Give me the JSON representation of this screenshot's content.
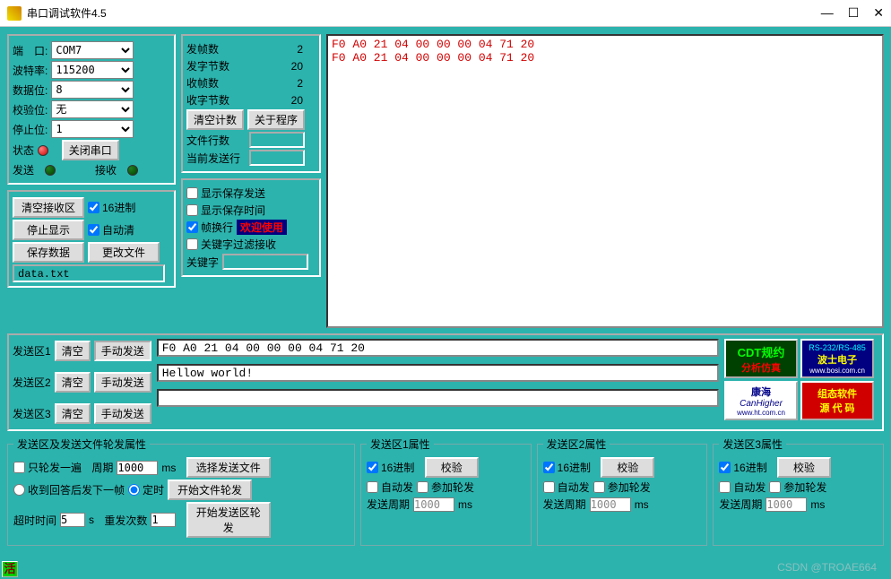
{
  "window": {
    "title": "串口调试软件4.5"
  },
  "port_settings": {
    "port_label": "端　口:",
    "port_value": "COM7",
    "baud_label": "波特率:",
    "baud_value": "115200",
    "databits_label": "数据位:",
    "databits_value": "8",
    "parity_label": "校验位:",
    "parity_value": "无",
    "stopbits_label": "停止位:",
    "stopbits_value": "1",
    "status_label": "状态",
    "close_btn": "关闭串口",
    "send_label": "发送",
    "recv_label": "接收"
  },
  "recv_controls": {
    "clear_recv": "清空接收区",
    "hex_chk": "16进制",
    "stop_display": "停止显示",
    "auto_clear_chk": "自动清",
    "save_data": "保存数据",
    "change_file": "更改文件",
    "filename": "data.txt"
  },
  "stats": {
    "tx_frames_label": "发帧数",
    "tx_frames": "2",
    "tx_bytes_label": "发字节数",
    "tx_bytes": "20",
    "rx_frames_label": "收帧数",
    "rx_frames": "2",
    "rx_bytes_label": "收字节数",
    "rx_bytes": "20",
    "clear_count": "清空计数",
    "about": "关于程序",
    "file_lines_label": "文件行数",
    "file_lines": "",
    "cur_send_label": "当前发送行",
    "cur_send": ""
  },
  "recv_options": {
    "show_save_send": "显示保存发送",
    "show_save_time": "显示保存时间",
    "frame_wrap": "帧换行",
    "welcome": "欢迎使用",
    "keyword_filter": "关键字过滤接收",
    "keyword_label": "关键字",
    "keyword_value": ""
  },
  "recv_data": "F0 A0 21 04 00 00 00 04 71 20\nF0 A0 21 04 00 00 00 04 71 20",
  "send_areas": {
    "area1_label": "发送区1",
    "area2_label": "发送区2",
    "area3_label": "发送区3",
    "clear": "清空",
    "manual": "手动发送",
    "area1_value": "F0 A0 21 04 00 00 00 04 71 20",
    "area2_value": "Hellow world!",
    "area3_value": ""
  },
  "poll_settings": {
    "legend": "发送区及发送文件轮发属性",
    "once_chk": "只轮发一遍",
    "period_label": "周期",
    "period_value": "1000",
    "ms": "ms",
    "select_file": "选择发送文件",
    "reply_next": "收到回答后发下一帧",
    "timed": "定时",
    "start_file_poll": "开始文件轮发",
    "timeout_label": "超时时间",
    "timeout_value": "5",
    "s": "s",
    "retry_label": "重发次数",
    "retry_value": "1",
    "start_area_poll": "开始发送区轮发"
  },
  "area_props": {
    "legend1": "发送区1属性",
    "legend2": "发送区2属性",
    "legend3": "发送区3属性",
    "hex_chk": "16进制",
    "check_btn": "校验",
    "auto_send": "自动发",
    "join_poll": "参加轮发",
    "send_period": "发送周期",
    "period_value": "1000",
    "ms": "ms"
  },
  "ads": {
    "cdt1": "CDT规约",
    "cdt2": "分析仿真",
    "bosi1": "RS-232/RS-485",
    "bosi2": "波士电子",
    "bosi3": "www.bosi.com.cn",
    "canh1": "康海",
    "canh2": "CanHigher",
    "canh3": "www.ht.com.cn",
    "src1": "组态软件",
    "src2": "源 代 码"
  },
  "status_corner": "活",
  "watermark": "CSDN @TROAE664"
}
